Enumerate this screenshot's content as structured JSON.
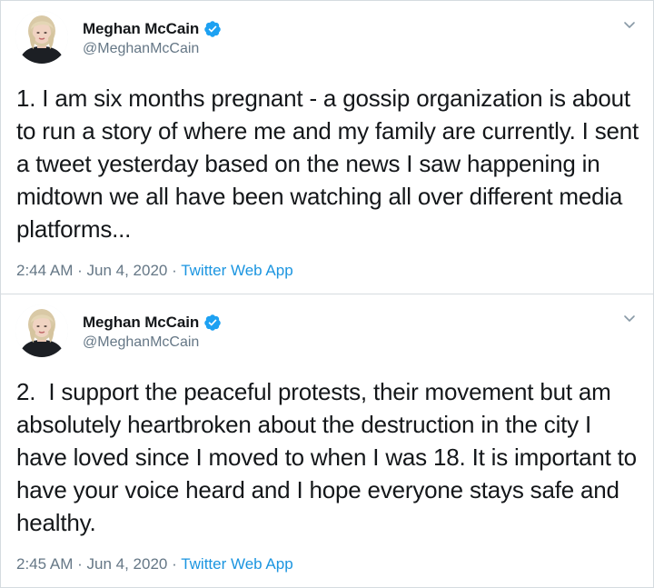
{
  "tweets": [
    {
      "display_name": "Meghan McCain",
      "handle": "@MeghanMcCain",
      "verified": true,
      "text": "1. I am six months pregnant - a gossip organization is about to run a story of where me and my family are currently. I sent a tweet yesterday based on the news I saw happening in midtown we all have been watching all over different media platforms...",
      "time": "2:44 AM",
      "separator": "·",
      "date": "Jun 4, 2020",
      "source": "Twitter Web App"
    },
    {
      "display_name": "Meghan McCain",
      "handle": "@MeghanMcCain",
      "verified": true,
      "text": "2.  I support the peaceful protests, their movement but am absolutely heartbroken about the destruction in the city I have loved since I moved to when I was 18. It is important to have your voice heard and I hope everyone stays safe and healthy.",
      "time": "2:45 AM",
      "separator": "·",
      "date": "Jun 4, 2020",
      "source": "Twitter Web App"
    }
  ],
  "colors": {
    "text_primary": "#14171a",
    "text_secondary": "#657786",
    "link": "#1b95e0",
    "verified_badge": "#1da1f2",
    "border": "#d5dbe0"
  },
  "icons": {
    "verified": "verified-badge-icon",
    "menu": "chevron-down-icon",
    "avatar": "profile-photo"
  }
}
